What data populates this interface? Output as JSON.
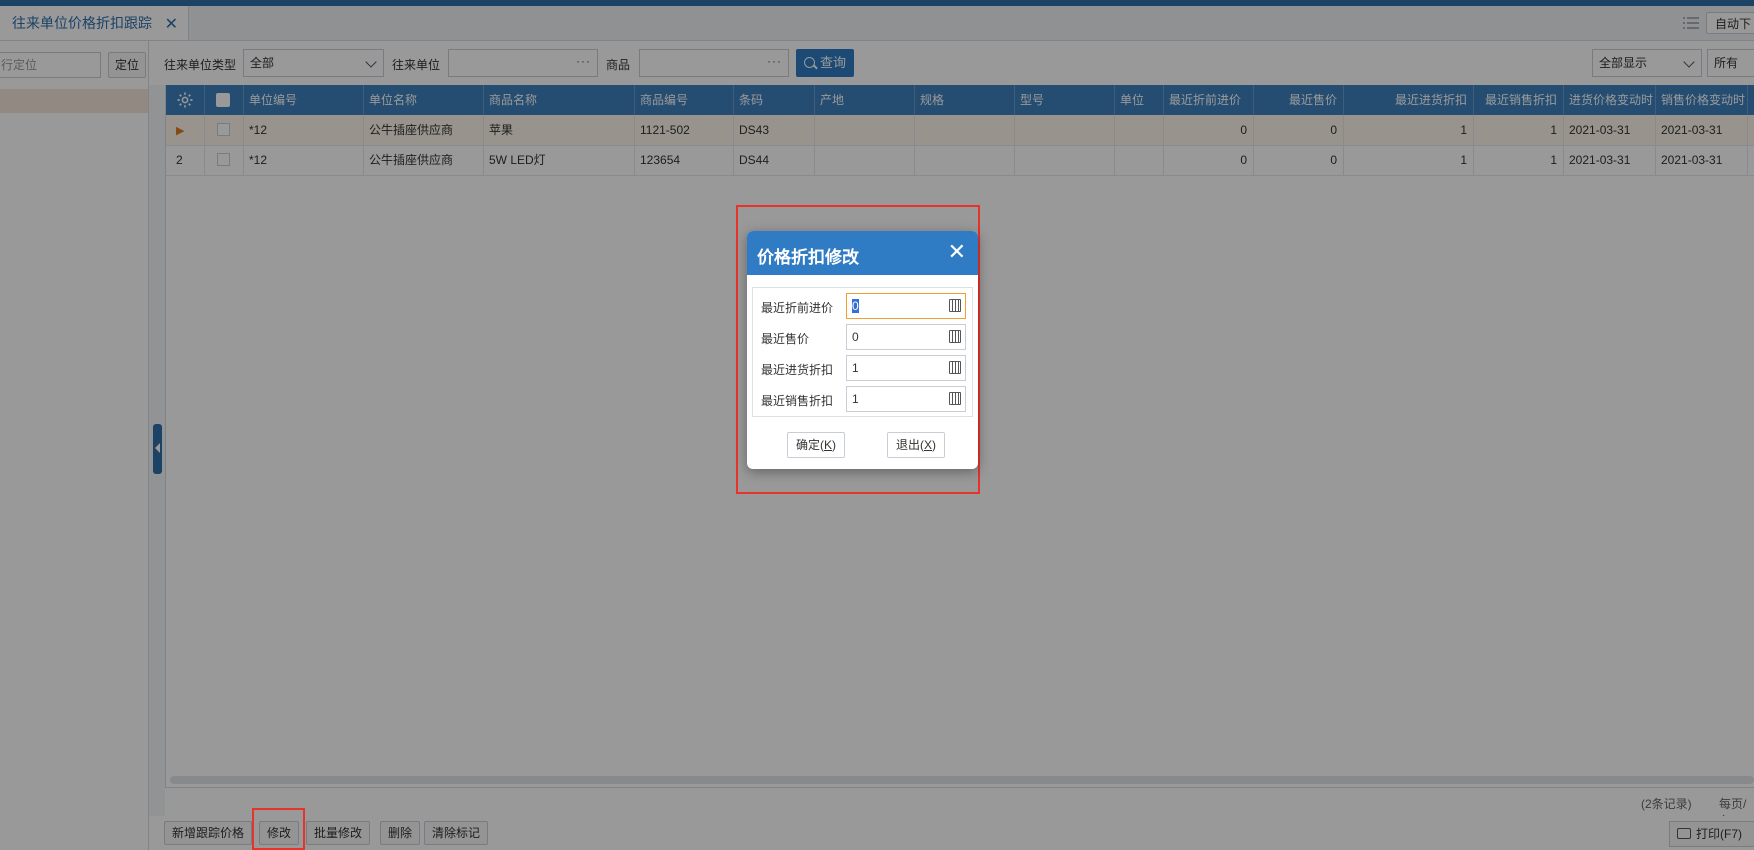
{
  "tab": {
    "title": "往来单位价格折扣跟踪",
    "close": "✕"
  },
  "toolbar_right": {
    "auto_label": "自动下"
  },
  "left": {
    "locate_placeholder": "行定位",
    "locate_btn": "定位"
  },
  "filters": {
    "unit_type_label": "往来单位类型",
    "unit_type_value": "全部",
    "unit_label": "往来单位",
    "goods_label": "商品",
    "dots": "···",
    "query_label": "查询",
    "display_value": "全部显示",
    "scope_value": "所有"
  },
  "grid": {
    "columns": [
      "单位编号",
      "单位名称",
      "商品名称",
      "商品编号",
      "条码",
      "产地",
      "规格",
      "型号",
      "单位",
      "最近折前进价",
      "最近售价",
      "最近进货折扣",
      "最近销售折扣",
      "进货价格变动时",
      "销售价格变动时"
    ],
    "rows": [
      {
        "marker": "▶",
        "unit_code": "*12",
        "unit_name": "公牛插座供应商",
        "goods_name": "苹果",
        "goods_code": "1121-502",
        "barcode": "DS43",
        "origin": "",
        "spec": "",
        "model": "",
        "unit": "",
        "last_pre_price": "0",
        "last_sale_price": "0",
        "last_purchase_discount": "1",
        "last_sale_discount": "1",
        "purchase_change": "2021-03-31",
        "sale_change": "2021-03-31"
      },
      {
        "marker": "2",
        "unit_code": "*12",
        "unit_name": "公牛插座供应商",
        "goods_name": "5W LED灯",
        "goods_code": "123654",
        "barcode": "DS44",
        "origin": "",
        "spec": "",
        "model": "",
        "unit": "",
        "last_pre_price": "0",
        "last_sale_price": "0",
        "last_purchase_discount": "1",
        "last_sale_discount": "1",
        "purchase_change": "2021-03-31",
        "sale_change": "2021-03-31"
      }
    ]
  },
  "status": {
    "records": "(2条记录)",
    "per_page": "每页/条"
  },
  "bottom": {
    "add": "新增跟踪价格",
    "edit": "修改",
    "batch_edit": "批量修改",
    "delete": "删除",
    "clear": "清除标记",
    "print": "打印(F7)"
  },
  "dialog": {
    "title": "价格折扣修改",
    "close": "✕",
    "fields": [
      {
        "label": "最近折前进价",
        "value": "0"
      },
      {
        "label": "最近售价",
        "value": "0"
      },
      {
        "label": "最近进货折扣",
        "value": "1"
      },
      {
        "label": "最近销售折扣",
        "value": "1"
      }
    ],
    "ok_label": "确定(",
    "ok_key": "K",
    "cancel_label": "退出(",
    "cancel_key": "X",
    "paren": ")"
  },
  "colors": {
    "accent": "#2f7cc4",
    "header": "#3f80bd",
    "highlight": "#e8332b"
  }
}
